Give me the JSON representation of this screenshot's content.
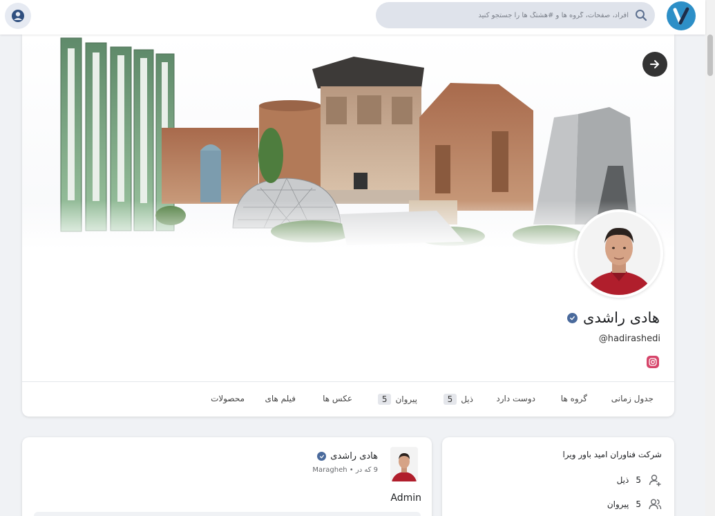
{
  "header": {
    "search_placeholder": "افراد، صفحات، گروه ها و #هشتگ ها را جستجو کنید",
    "logo_letter": "V"
  },
  "profile": {
    "name": "هادی راشدی",
    "username": "@hadirashedi"
  },
  "tabs": [
    {
      "label": "جدول زمانی",
      "count": ""
    },
    {
      "label": "گروه ها",
      "count": ""
    },
    {
      "label": "دوست دارد",
      "count": ""
    },
    {
      "label": "ذیل",
      "count": "5"
    },
    {
      "label": "پیروان",
      "count": "5"
    },
    {
      "label": "عکس ها",
      "count": ""
    },
    {
      "label": "فیلم های",
      "count": ""
    },
    {
      "label": "محصولات",
      "count": ""
    }
  ],
  "post": {
    "author": "هادی راشدی",
    "time": "9 که در",
    "location": "Maragheh",
    "separator": "•",
    "text": "Admin"
  },
  "info": {
    "company": "شرکت فناوران امید باور ویرا",
    "following_count": "5",
    "following_label": "ذیل",
    "followers_count": "5",
    "followers_label": "پیروان"
  },
  "colors": {
    "accent": "#4a6a9c",
    "logo": "#2d8fc7",
    "instagram": "#d6456a",
    "background": "#f0f2f5"
  },
  "icons": [
    "user-circle-icon",
    "logo-icon",
    "search-icon",
    "arrow-right-icon",
    "verified-icon",
    "instagram-icon",
    "user-plus-icon",
    "users-icon"
  ]
}
